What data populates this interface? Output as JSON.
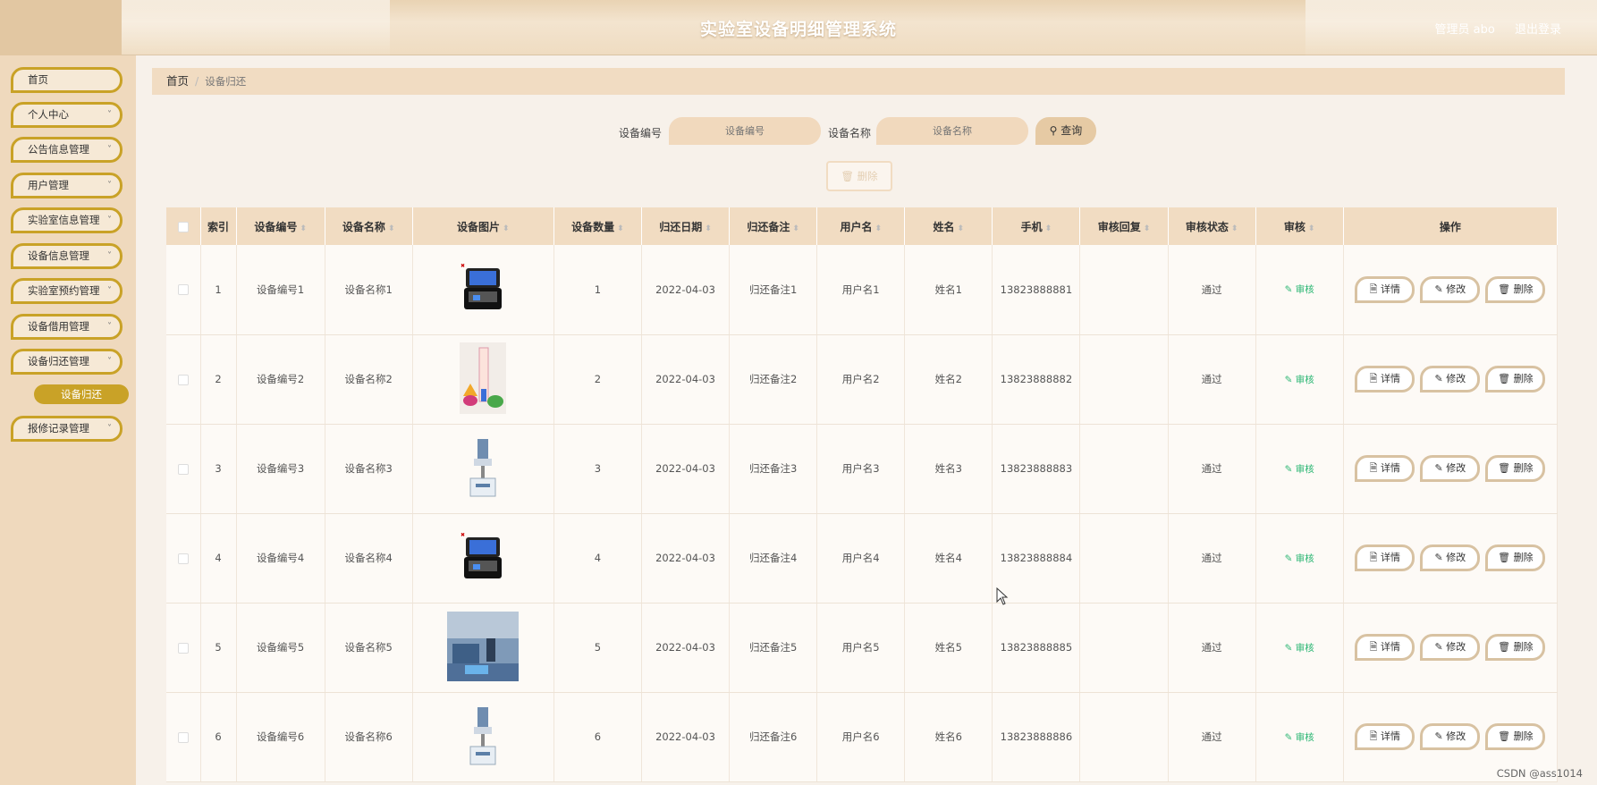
{
  "header": {
    "title": "实验室设备明细管理系统",
    "admin_label": "管理员 abo",
    "logout_label": "退出登录"
  },
  "sidebar": {
    "items": [
      {
        "label": "首页",
        "has_chevron": false
      },
      {
        "label": "个人中心",
        "has_chevron": true
      },
      {
        "label": "公告信息管理",
        "has_chevron": true
      },
      {
        "label": "用户管理",
        "has_chevron": true
      },
      {
        "label": "实验室信息管理",
        "has_chevron": true
      },
      {
        "label": "设备信息管理",
        "has_chevron": true
      },
      {
        "label": "实验室预约管理",
        "has_chevron": true
      },
      {
        "label": "设备借用管理",
        "has_chevron": true
      },
      {
        "label": "设备归还管理",
        "has_chevron": true
      },
      {
        "label": "报修记录管理",
        "has_chevron": true
      }
    ],
    "active_sub": "设备归还"
  },
  "breadcrumb": {
    "home": "首页",
    "separator": "/",
    "current": "设备归还"
  },
  "search": {
    "label1": "设备编号",
    "placeholder1": "设备编号",
    "label2": "设备名称",
    "placeholder2": "设备名称",
    "query_btn": "查询",
    "delete_btn": "删除"
  },
  "table": {
    "columns": [
      "索引",
      "设备编号",
      "设备名称",
      "设备图片",
      "设备数量",
      "归还日期",
      "归还备注",
      "用户名",
      "姓名",
      "手机",
      "审核回复",
      "审核状态",
      "审核",
      "操作"
    ],
    "audit_label": "审核",
    "actions": {
      "detail": "详情",
      "edit": "修改",
      "delete": "删除"
    },
    "rows": [
      {
        "index": "1",
        "code": "设备编号1",
        "name": "设备名称1",
        "image": "equipment-case",
        "qty": "1",
        "date": "2022-04-03",
        "remark": "归还备注1",
        "username": "用户名1",
        "realname": "姓名1",
        "phone": "13823888881",
        "reply": "",
        "status": "通过"
      },
      {
        "index": "2",
        "code": "设备编号2",
        "name": "设备名称2",
        "image": "lab-glassware",
        "qty": "2",
        "date": "2022-04-03",
        "remark": "归还备注2",
        "username": "用户名2",
        "realname": "姓名2",
        "phone": "13823888882",
        "reply": "",
        "status": "通过"
      },
      {
        "index": "3",
        "code": "设备编号3",
        "name": "设备名称3",
        "image": "lab-instrument",
        "qty": "3",
        "date": "2022-04-03",
        "remark": "归还备注3",
        "username": "用户名3",
        "realname": "姓名3",
        "phone": "13823888883",
        "reply": "",
        "status": "通过"
      },
      {
        "index": "4",
        "code": "设备编号4",
        "name": "设备名称4",
        "image": "equipment-case",
        "qty": "4",
        "date": "2022-04-03",
        "remark": "归还备注4",
        "username": "用户名4",
        "realname": "姓名4",
        "phone": "13823888884",
        "reply": "",
        "status": "通过"
      },
      {
        "index": "5",
        "code": "设备编号5",
        "name": "设备名称5",
        "image": "lab-room-photo",
        "qty": "5",
        "date": "2022-04-03",
        "remark": "归还备注5",
        "username": "用户名5",
        "realname": "姓名5",
        "phone": "13823888885",
        "reply": "",
        "status": "通过"
      },
      {
        "index": "6",
        "code": "设备编号6",
        "name": "设备名称6",
        "image": "lab-instrument",
        "qty": "6",
        "date": "2022-04-03",
        "remark": "归还备注6",
        "username": "用户名6",
        "realname": "姓名6",
        "phone": "13823888886",
        "reply": "",
        "status": "通过"
      }
    ]
  },
  "watermark": "CSDN @ass1014",
  "colors": {
    "accent": "#c9a227",
    "header_bg": "#efdcc1",
    "table_header_bg": "#f1dcc2",
    "audit_green": "#2bb673"
  }
}
